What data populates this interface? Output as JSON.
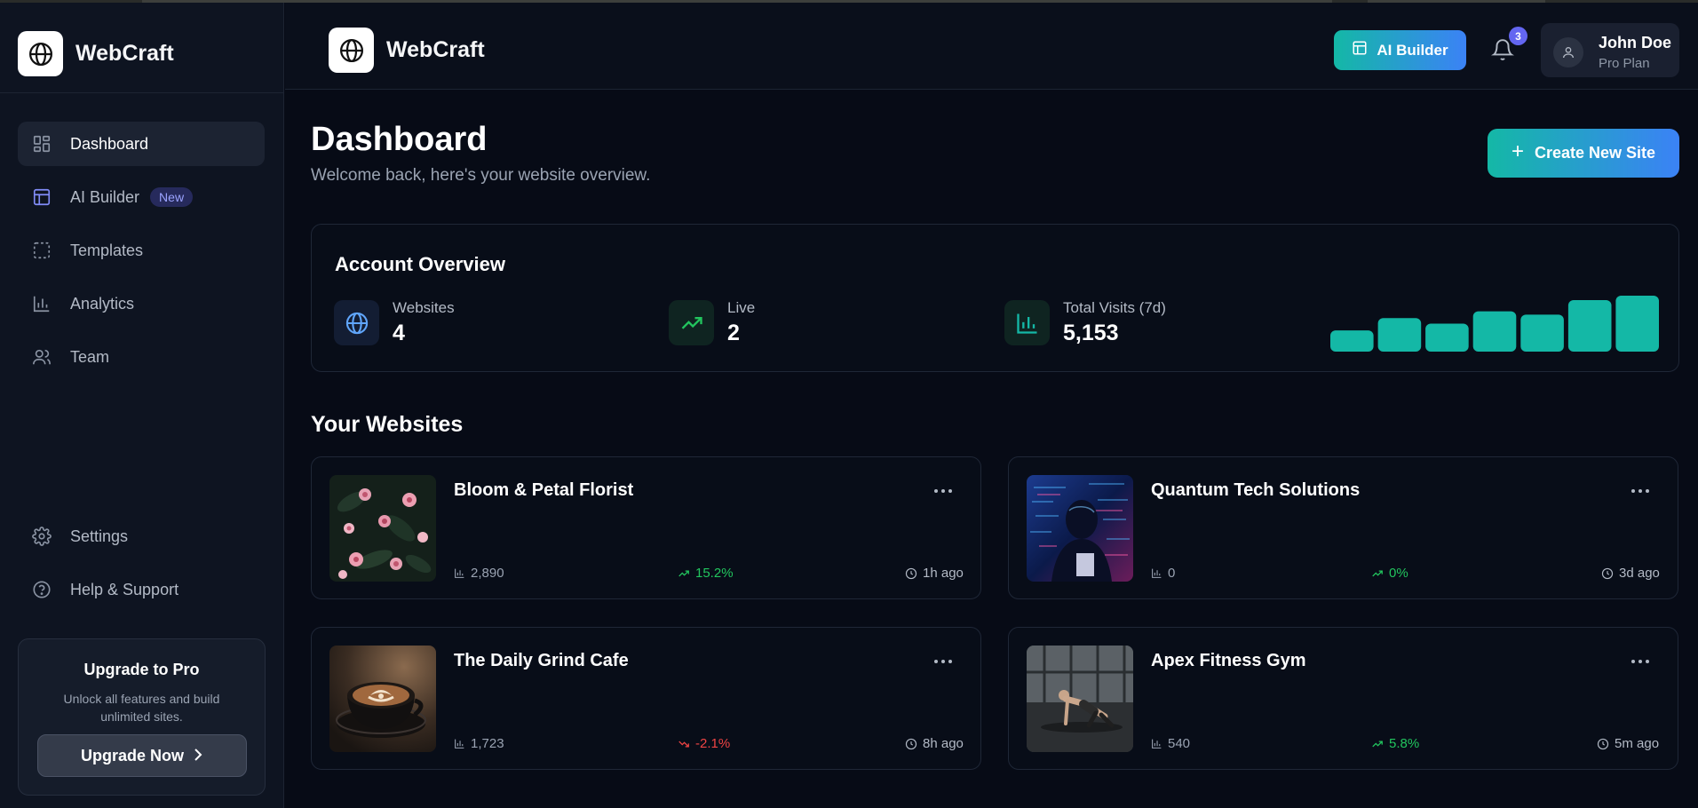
{
  "app": {
    "name": "WebCraft"
  },
  "sidebar": {
    "items": [
      {
        "label": "Dashboard",
        "icon": "dashboard-icon",
        "active": true
      },
      {
        "label": "AI Builder",
        "icon": "layout-icon",
        "badge": "New"
      },
      {
        "label": "Templates",
        "icon": "dashed-square-icon"
      },
      {
        "label": "Analytics",
        "icon": "bar-chart-icon"
      },
      {
        "label": "Team",
        "icon": "users-icon"
      }
    ],
    "bottom_items": [
      {
        "label": "Settings",
        "icon": "gear-icon"
      },
      {
        "label": "Help & Support",
        "icon": "help-circle-icon"
      }
    ],
    "upgrade": {
      "title": "Upgrade to Pro",
      "description": "Unlock all features and build unlimited sites.",
      "button": "Upgrade Now"
    }
  },
  "header": {
    "ai_builder_label": "AI Builder",
    "notification_count": "3",
    "user": {
      "name": "John Doe",
      "plan": "Pro Plan"
    }
  },
  "main": {
    "title": "Dashboard",
    "subtitle": "Welcome back, here's your website overview.",
    "create_button": "Create New Site",
    "overview": {
      "title": "Account Overview",
      "stats": [
        {
          "label": "Websites",
          "value": "4",
          "icon": "globe-icon"
        },
        {
          "label": "Live",
          "value": "2",
          "icon": "trending-up-icon"
        },
        {
          "label": "Total Visits (7d)",
          "value": "5,153",
          "icon": "bar-chart-icon"
        }
      ],
      "mini_chart_levels": [
        0.38,
        0.6,
        0.5,
        0.72,
        0.66,
        0.92,
        1.0
      ]
    },
    "websites_title": "Your Websites",
    "websites": [
      {
        "name": "Bloom & Petal Florist",
        "visits": "2,890",
        "change": "15.2%",
        "trend": "up",
        "updated": "1h ago",
        "thumb": "flowers"
      },
      {
        "name": "Quantum Tech Solutions",
        "visits": "0",
        "change": "0%",
        "trend": "up",
        "updated": "3d ago",
        "thumb": "tech"
      },
      {
        "name": "The Daily Grind Cafe",
        "visits": "1,723",
        "change": "-2.1%",
        "trend": "down",
        "updated": "8h ago",
        "thumb": "coffee"
      },
      {
        "name": "Apex Fitness Gym",
        "visits": "540",
        "change": "5.8%",
        "trend": "up",
        "updated": "5m ago",
        "thumb": "gym"
      }
    ]
  },
  "colors": {
    "accent_teal": "#14b8a6",
    "accent_blue": "#3b82f6",
    "positive": "#22c55e",
    "negative": "#ef4444",
    "badge_purple": "#6366f1"
  }
}
